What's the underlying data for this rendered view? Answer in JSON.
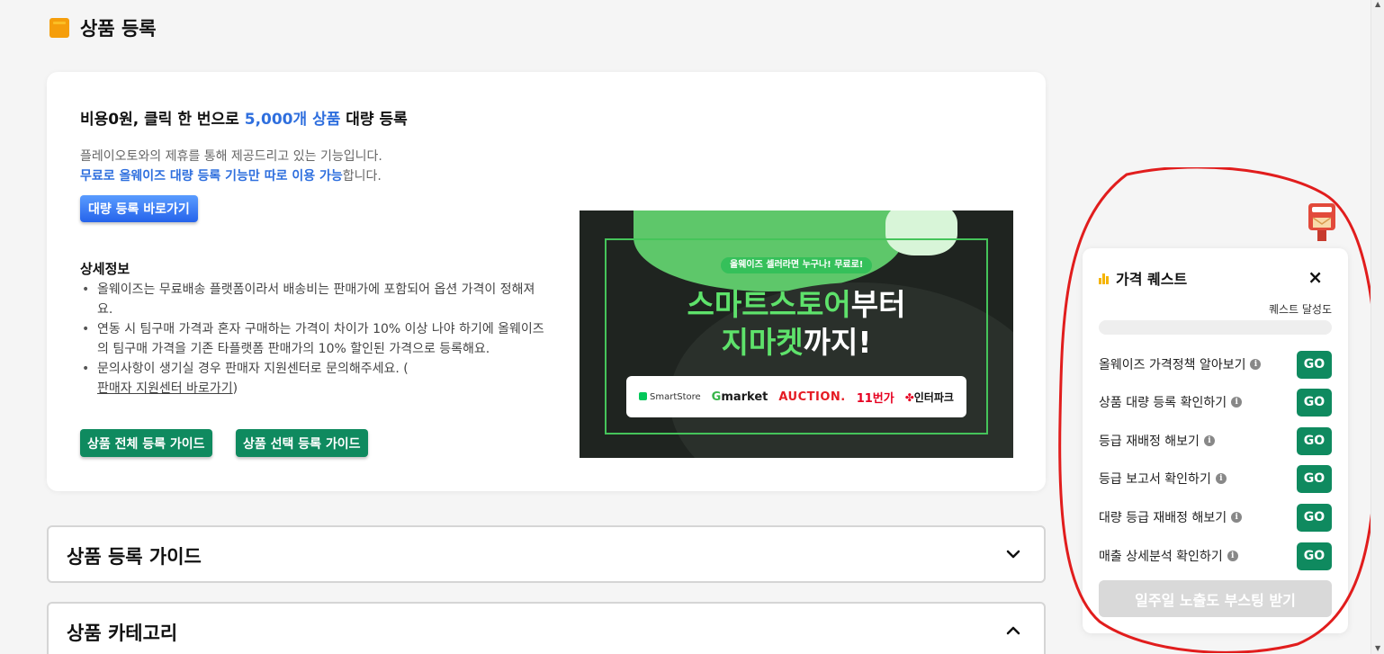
{
  "header": {
    "title": "상품 등록",
    "icon": "box-icon"
  },
  "promo": {
    "title_pre": "비용0원, 클릭 한 번으로 ",
    "title_highlight": "5,000개 상품",
    "title_post": " 대량 등록",
    "desc_line1": "플레이오토와의 제휴를 통해 제공드리고 있는 기능입니다.",
    "desc_line2_highlight": "무료로 올웨이즈 대량 등록 기능만 따로 이용 가능",
    "desc_line2_post": "합니다.",
    "shortcut_button": "대량 등록 바로가기"
  },
  "details": {
    "title": "상세정보",
    "items": [
      "올웨이즈는 무료배송 플랫폼이라서 배송비는 판매가에 포함되어 옵션 가격이 정해져요.",
      "연동 시 팀구매 가격과 혼자 구매하는 가격이 차이가 10% 이상 나야 하기에 올웨이즈의 팀구매 가격을 기존 타플랫폼 판매가의 10% 할인된 가격으로 등록해요."
    ],
    "item3_pre": "문의사항이 생기실 경우 판매자 지원센터로 문의해주세요. (",
    "item3_link": "판매자 지원센터 바로가기",
    "item3_post": ")",
    "guide_all_button": "상품 전체 등록 가이드",
    "guide_select_button": "상품 선택 등록 가이드"
  },
  "banner": {
    "pill": "올웨이즈 셀러라면 누구나! 무료로!",
    "line1_green": "스마트스토어",
    "line1_white": "부터",
    "line2_green": "지마켓",
    "line2_white": "까지!",
    "logos": {
      "smartstore": "SmartStore",
      "gmarket_g": "G",
      "gmarket_rest": "market",
      "auction": "AUCTION.",
      "st11": "11번가",
      "interpark": "인터파크"
    }
  },
  "accordions": [
    {
      "title": "상품 등록 가이드",
      "state": "collapsed"
    },
    {
      "title": "상품 카테고리",
      "state": "expanded"
    }
  ],
  "quest": {
    "title": "가격 퀘스트",
    "close": "×",
    "progress_label": "퀘스트 달성도",
    "progress": 0,
    "items": [
      {
        "label": "올웨이즈 가격정책 알아보기",
        "action": "GO"
      },
      {
        "label": "상품 대량 등록 확인하기",
        "action": "GO"
      },
      {
        "label": "등급 재배정 해보기",
        "action": "GO"
      },
      {
        "label": "등급 보고서 확인하기",
        "action": "GO"
      },
      {
        "label": "대량 등급 재배정 해보기",
        "action": "GO"
      },
      {
        "label": "매출 상세분석 확인하기",
        "action": "GO"
      }
    ],
    "boost_button": "일주일 노출도 부스팅 받기"
  },
  "colors": {
    "accent_blue": "#2f6fde",
    "go_green": "#0f8a5f",
    "annotation_red": "#e11d1d",
    "header_icon": "#f59e0b"
  }
}
